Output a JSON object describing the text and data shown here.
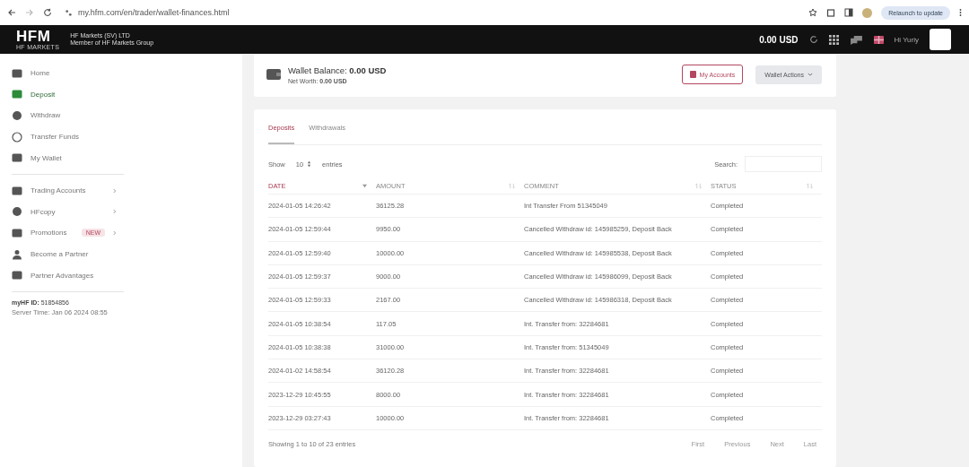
{
  "browser": {
    "url": "my.hfm.com/en/trader/wallet-finances.html",
    "update_button": "Relaunch to update"
  },
  "header": {
    "logo": "HFM",
    "logo_sub": "HF MARKETS",
    "company": "HF Markets (SV) LTD",
    "company_sub": "Member of HF Markets Group",
    "balance": "0.00 USD",
    "user": "Hi Yuriy"
  },
  "sidebar": {
    "groups": [
      [
        {
          "label": "Home",
          "selected": false
        },
        {
          "label": "Deposit",
          "selected": true
        },
        {
          "label": "Withdraw",
          "selected": false
        },
        {
          "label": "Transfer Funds",
          "selected": false
        },
        {
          "label": "My Wallet",
          "selected": false
        }
      ],
      [
        {
          "label": "Trading Accounts",
          "selected": false,
          "has_submenu": true
        },
        {
          "label": "HFcopy",
          "selected": false,
          "has_submenu": true
        },
        {
          "label": "Promotions",
          "selected": false,
          "has_submenu": true,
          "badge": "NEW"
        },
        {
          "label": "Become a Partner",
          "selected": false,
          "has_submenu": false
        },
        {
          "label": "Partner Advantages",
          "selected": false,
          "has_submenu": false
        }
      ]
    ],
    "id_label": "myHF ID:",
    "id_value": "51854856",
    "server_time": "Server Time: Jan 06 2024 08:55"
  },
  "wallet": {
    "balance_label": "Wallet Balance:",
    "balance": "0.00 USD",
    "net_worth_label": "Net Worth:",
    "net_worth": "0.00 USD",
    "my_accounts": "My Accounts",
    "wallet_actions": "Wallet Actions"
  },
  "tabs": [
    {
      "label": "Deposits",
      "selected": true
    },
    {
      "label": "Withdrawals",
      "selected": false
    }
  ],
  "show_label": "Show",
  "page_size": "10",
  "entries_label": "entries",
  "search_label": "Search:",
  "table": {
    "columns": [
      {
        "label": "DATE",
        "sorted": true
      },
      {
        "label": "AMOUNT",
        "sorted": false
      },
      {
        "label": "COMMENT",
        "sorted": false
      },
      {
        "label": "STATUS",
        "sorted": false
      }
    ],
    "rows": [
      [
        "2024-01-05 14:26:42",
        "36125.28",
        "Int Transfer From 51345049",
        "Completed"
      ],
      [
        "2024-01-05 12:59:44",
        "9950.00",
        "Cancelled Withdraw id: 145985259, Deposit Back",
        "Completed"
      ],
      [
        "2024-01-05 12:59:40",
        "10000.00",
        "Cancelled Withdraw id: 145985538, Deposit Back",
        "Completed"
      ],
      [
        "2024-01-05 12:59:37",
        "9000.00",
        "Cancelled Withdraw id: 145986099, Deposit Back",
        "Completed"
      ],
      [
        "2024-01-05 12:59:33",
        "2167.00",
        "Cancelled Withdraw id: 145986318, Deposit Back",
        "Completed"
      ],
      [
        "2024-01-05 10:38:54",
        "117.05",
        "Int. Transfer from: 32284681",
        "Completed"
      ],
      [
        "2024-01-05 10:38:38",
        "31000.00",
        "Int. Transfer from: 51345049",
        "Completed"
      ],
      [
        "2024-01-02 14:58:54",
        "36120.28",
        "Int. Transfer from: 32284681",
        "Completed"
      ],
      [
        "2023-12-29 10:45:55",
        "8000.00",
        "Int. Transfer from: 32284681",
        "Completed"
      ],
      [
        "2023-12-29 03:27:43",
        "10000.00",
        "Int. Transfer from: 32284681",
        "Completed"
      ]
    ]
  },
  "footer": {
    "info": "Showing 1 to 10 of 23 entries",
    "pager": [
      "First",
      "Previous",
      "Next",
      "Last"
    ]
  }
}
